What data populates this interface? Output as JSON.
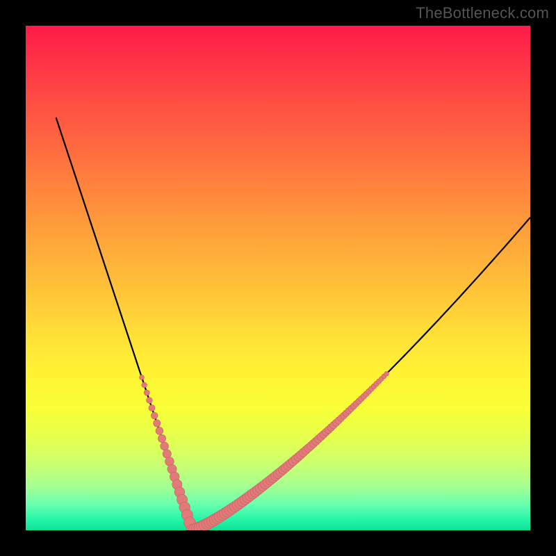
{
  "watermark": "TheBottleneck.com",
  "colors": {
    "bead_fill": "#e27a7a",
    "bead_stroke": "#c46060",
    "curve_stroke": "#000000",
    "frame": "#000000"
  },
  "chart_data": {
    "type": "line",
    "title": "",
    "xlabel": "",
    "ylabel": "",
    "x_sample_start": 0.06,
    "x_sample_end": 1.0,
    "x_sample_step": 0.01,
    "asymmetry_right": 0.62,
    "minimum_x": 0.33,
    "amplitude": 1.0,
    "ylim": [
      0,
      1
    ],
    "xlim": [
      0,
      1
    ],
    "series": [
      {
        "name": "bottleneck",
        "kind": "computed-v-curve"
      }
    ],
    "beads": {
      "y_threshold": 0.315,
      "radius_min": 3.2,
      "radius_max": 8.5,
      "sample_step": 0.005
    }
  }
}
